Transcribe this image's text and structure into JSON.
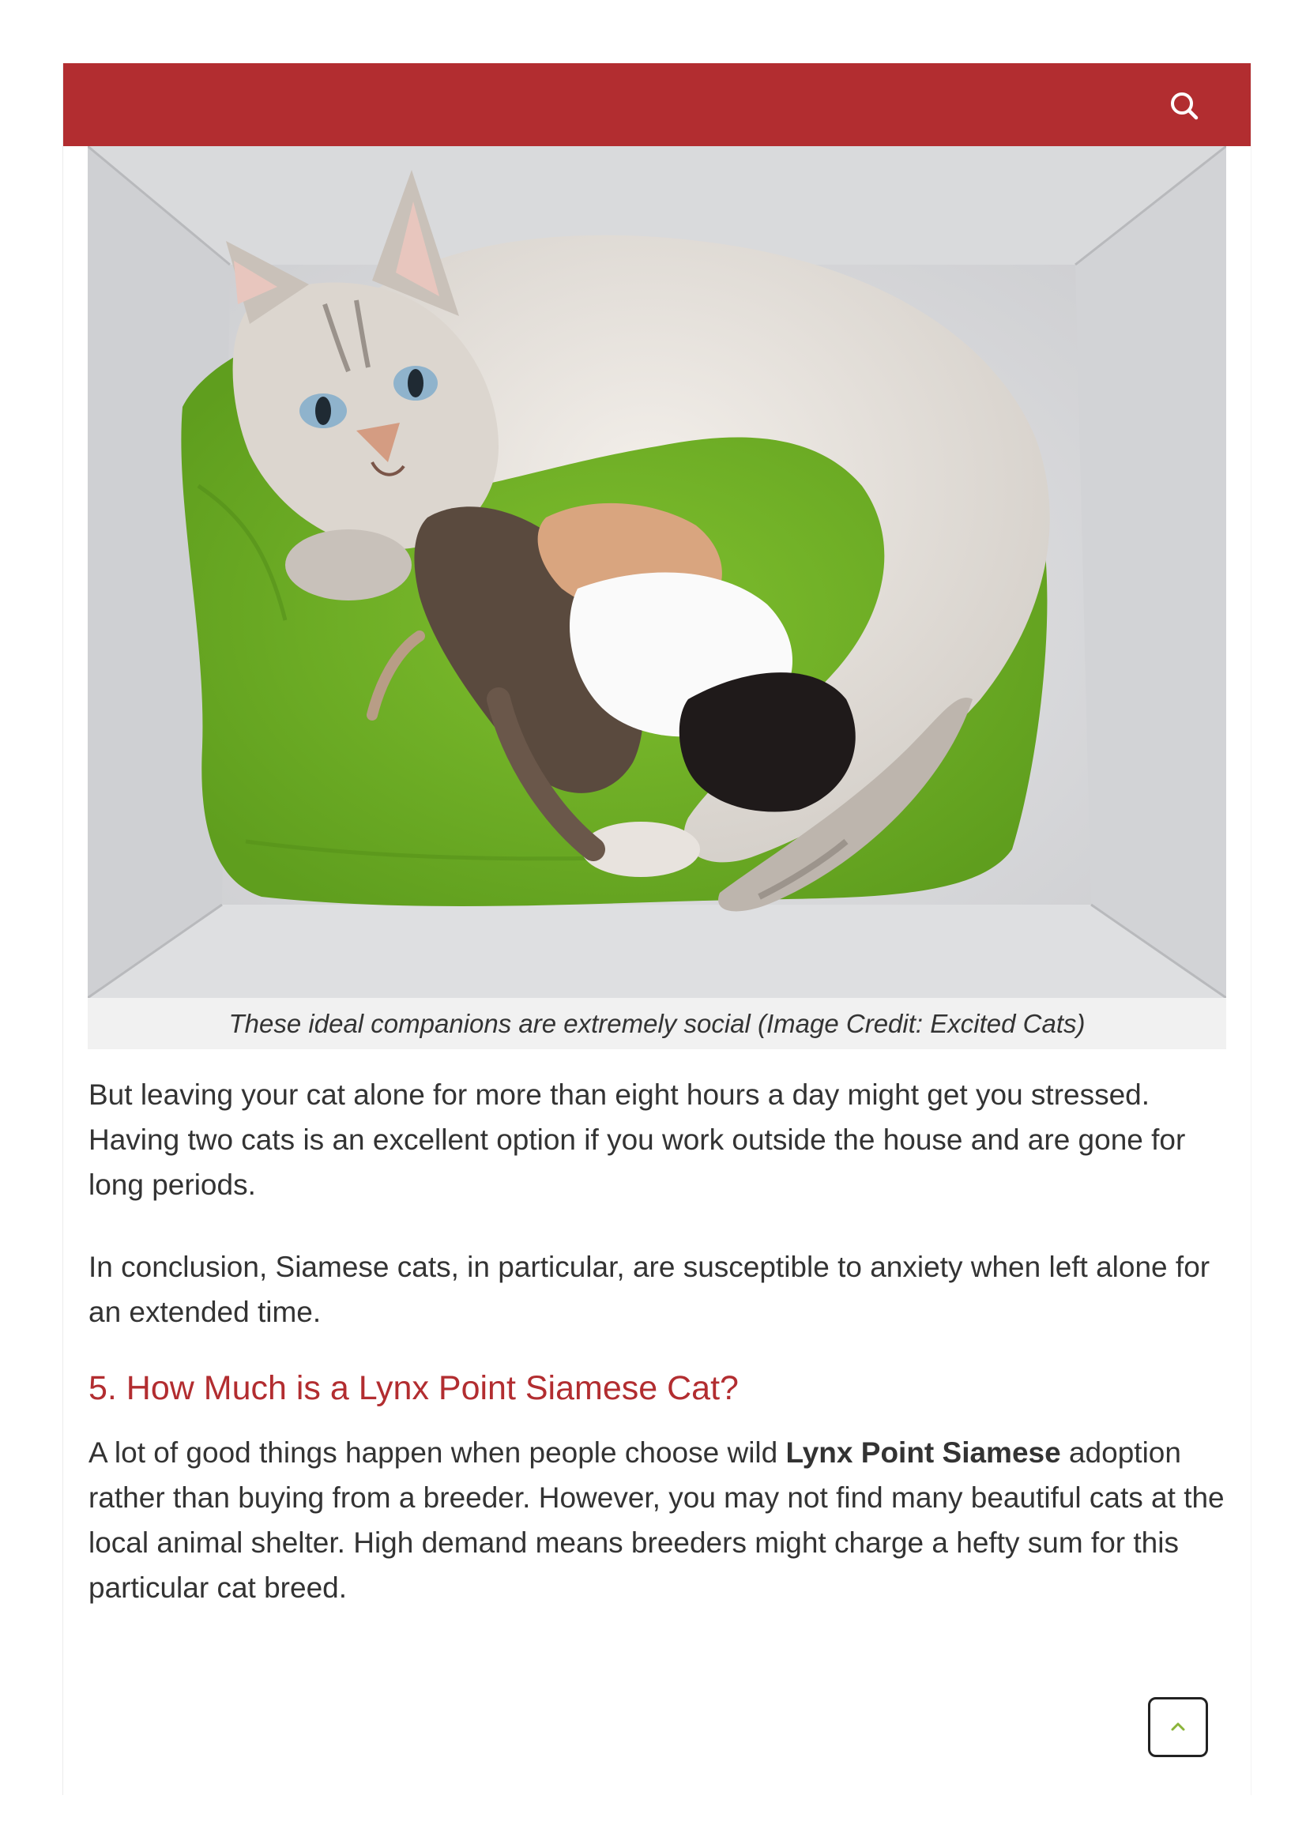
{
  "header": {
    "search_icon": "search-icon",
    "bar_color": "#b22d30"
  },
  "hero_image": {
    "subject": "cat-nursing-kittens-photo"
  },
  "caption": "These ideal companions are extremely social (Image Credit: Excited Cats)",
  "article": {
    "paragraph_1": "But leaving your cat alone for more than eight hours a day might get you stressed. Having two cats is an excellent option if you work outside the house and are gone for long periods.",
    "paragraph_2": "In conclusion, Siamese cats, in particular, are susceptible to anxiety when left alone for an extended time.",
    "heading": "5. How Much is a Lynx Point Siamese Cat?",
    "paragraph_3_before": "A lot of good things happen when people choose wild ",
    "paragraph_3_bold": "Lynx Point Siamese",
    "paragraph_3_after": " adoption rather than buying from a breeder. However, you may not find many beautiful cats at the local animal shelter. High demand means breeders might charge a hefty sum for this particular cat breed."
  },
  "scroll_top": {
    "icon": "chevron-up-icon",
    "accent_color": "#8bb43a"
  }
}
